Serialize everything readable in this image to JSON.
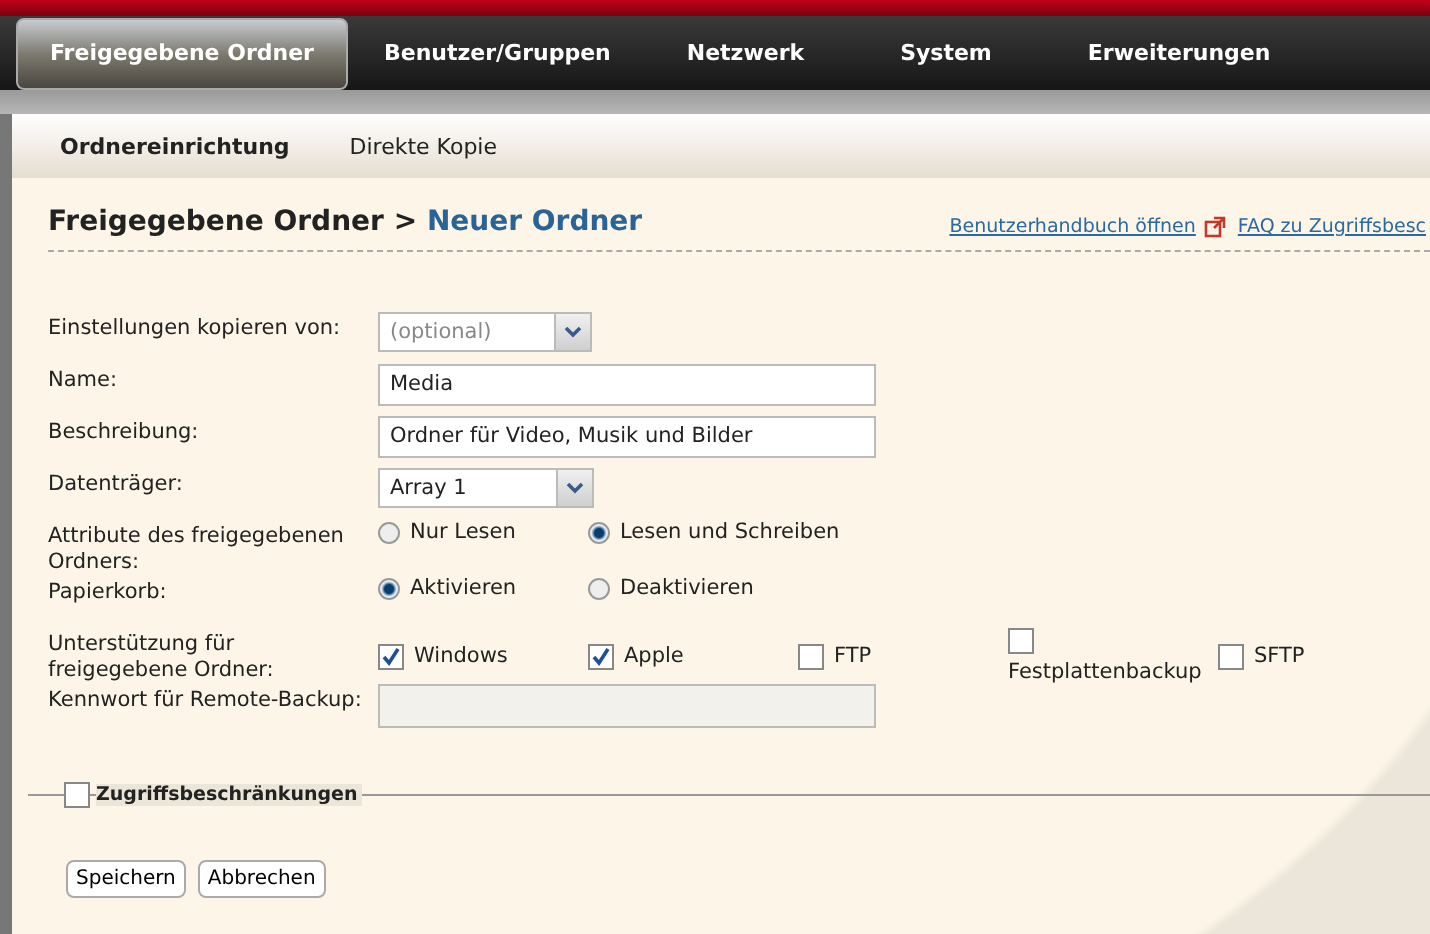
{
  "nav_tabs": [
    {
      "label": "Freigegebene Ordner",
      "selected": true
    },
    {
      "label": "Benutzer/Gruppen",
      "selected": false
    },
    {
      "label": "Netzwerk",
      "selected": false
    },
    {
      "label": "System",
      "selected": false
    },
    {
      "label": "Erweiterungen",
      "selected": false
    }
  ],
  "sub_tabs": [
    {
      "label": "Ordnereinrichtung",
      "selected": true
    },
    {
      "label": "Direkte Kopie",
      "selected": false
    }
  ],
  "breadcrumb": {
    "parent": "Freigegebene Ordner",
    "separator": ">",
    "current": "Neuer Ordner"
  },
  "links": [
    {
      "label": "Benutzerhandbuch öffnen",
      "external": true
    },
    {
      "label": "FAQ zu Zugriffsbesc",
      "external": false
    }
  ],
  "form": [
    {
      "kind": "select",
      "label": "Einstellungen kopieren von:",
      "placeholder": "(optional)"
    },
    {
      "kind": "text",
      "label": "Name:",
      "value": "Media"
    },
    {
      "kind": "text",
      "label": "Beschreibung:",
      "value": "Ordner für Video, Musik und Bilder"
    },
    {
      "kind": "select",
      "label": "Datenträger:",
      "value": "Array 1"
    },
    {
      "kind": "radio",
      "label": "Attribute des freigegebenen Ordners:",
      "options": [
        {
          "label": "Nur Lesen",
          "selected": false
        },
        {
          "label": "Lesen und Schreiben",
          "selected": true
        }
      ]
    },
    {
      "kind": "radio",
      "label": "Papierkorb:",
      "options": [
        {
          "label": "Aktivieren",
          "selected": true
        },
        {
          "label": "Deaktivieren",
          "selected": false
        }
      ]
    },
    {
      "kind": "checkbox",
      "label": "Unterstützung für freigegebene Ordner:",
      "options": [
        {
          "label": "Windows",
          "checked": true
        },
        {
          "label": "Apple",
          "checked": true
        },
        {
          "label": "FTP",
          "checked": false
        },
        {
          "label": "Festplattenbackup",
          "checked": false
        },
        {
          "label": "SFTP",
          "checked": false
        }
      ]
    },
    {
      "kind": "password",
      "label": "Kennwort für Remote-Backup:",
      "disabled": true
    }
  ],
  "access_section": {
    "label": "Zugriffsbeschränkungen",
    "checked": false
  },
  "buttons": [
    "Speichern",
    "Abbrechen"
  ]
}
